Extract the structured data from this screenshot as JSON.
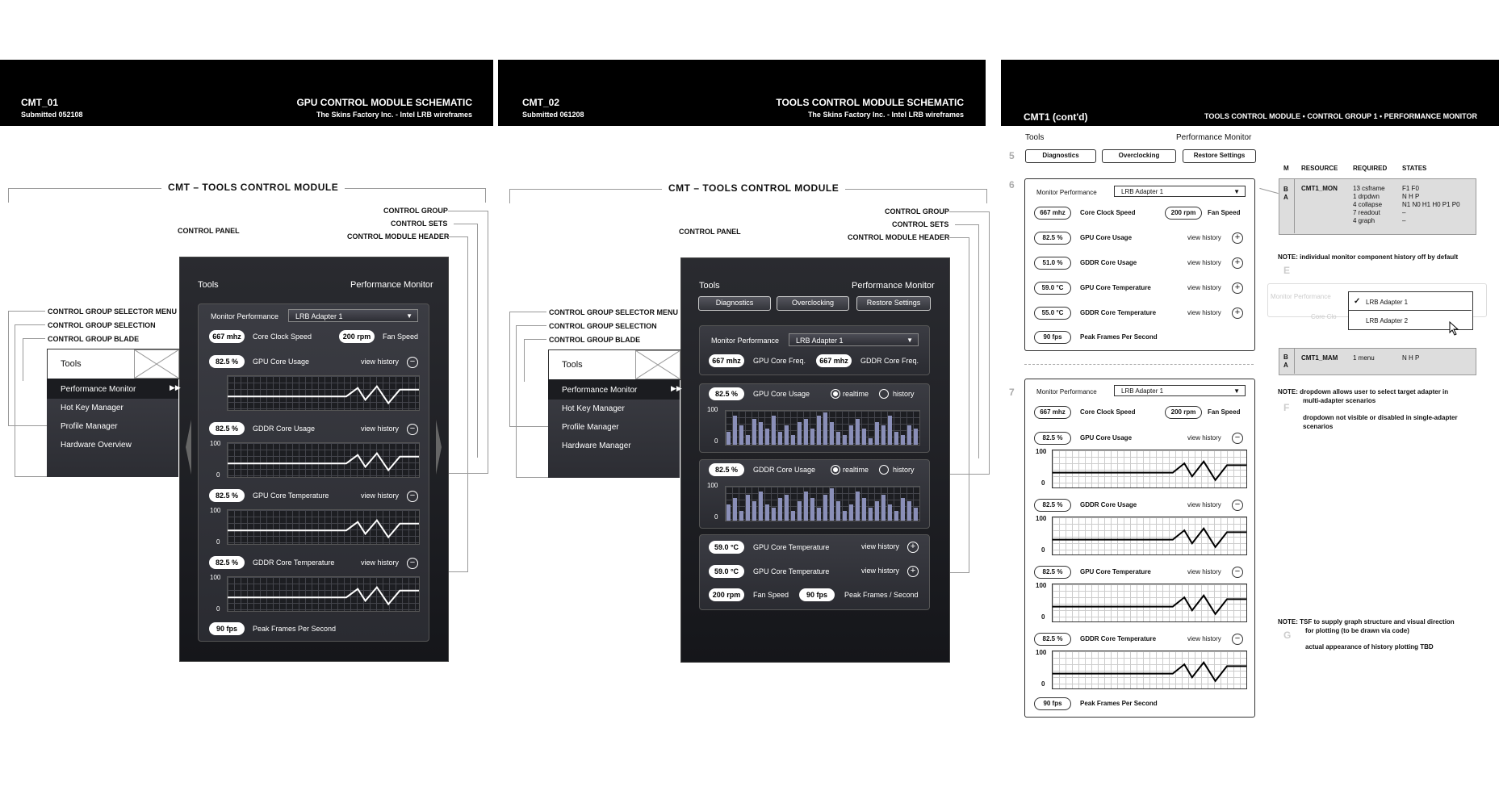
{
  "boards": [
    {
      "code": "CMT_01",
      "submitted": "Submitted 052108",
      "title": "GPU CONTROL MODULE SCHEMATIC",
      "subtitle": "The Skins Factory Inc. - Intel LRB wireframes",
      "section": "CMT – TOOLS CONTROL MODULE"
    },
    {
      "code": "CMT_02",
      "submitted": "Submitted 061208",
      "title": "TOOLS CONTROL MODULE SCHEMATIC",
      "subtitle": "The Skins Factory Inc. - Intel LRB wireframes",
      "section": "CMT – TOOLS CONTROL MODULE"
    },
    {
      "code": "CMT1 (cont'd)",
      "title": "TOOLS CONTROL MODULE • CONTROL GROUP 1 • PERFORMANCE MONITOR"
    }
  ],
  "callouts": {
    "control_group": "CONTROL GROUP",
    "control_sets": "CONTROL SETS",
    "control_module_header": "CONTROL MODULE HEADER",
    "control_panel": "CONTROL PANEL",
    "cg_selector_menu": "CONTROL GROUP SELECTOR MENU",
    "cg_selection": "CONTROL GROUP SELECTION",
    "cg_blade": "CONTROL GROUP BLADE"
  },
  "panel": {
    "tools": "Tools",
    "perf_monitor": "Performance Monitor"
  },
  "blade1": {
    "selected": "Tools",
    "items": [
      "Performance Monitor",
      "Hot Key Manager",
      "Profile Manager",
      "Hardware Overview"
    ]
  },
  "blade2": {
    "selected": "Tools",
    "items": [
      "Performance Monitor",
      "Hot Key Manager",
      "Profile Manager",
      "Hardware Manager"
    ]
  },
  "p1": {
    "monitor_label": "Monitor Performance",
    "adapter": "LRB Adapter 1",
    "clock": "667 mhz",
    "clock_label": "Core Clock Speed",
    "fan": "200 rpm",
    "fan_label": "Fan Speed",
    "rows": [
      {
        "value": "82.5 %",
        "label": "GPU Core Usage",
        "history": "view history"
      },
      {
        "value": "82.5 %",
        "label": "GDDR Core Usage",
        "history": "view history"
      },
      {
        "value": "82.5 %",
        "label": "GPU Core Temperature",
        "history": "view history"
      },
      {
        "value": "82.5 %",
        "label": "GDDR Core Temperature",
        "history": "view history"
      }
    ],
    "ymax": "100",
    "ymin": "0",
    "fps": "90 fps",
    "fps_label": "Peak Frames Per Second"
  },
  "p2": {
    "tabs": [
      "Diagnostics",
      "Overclocking",
      "Restore Settings"
    ],
    "monitor_label": "Monitor Performance",
    "adapter": "LRB Adapter 1",
    "gpu_freq": "667 mhz",
    "gpu_freq_label": "GPU Core Freq.",
    "gddr_freq": "667 mhz",
    "gddr_freq_label": "GDDR Core Freq.",
    "usage": [
      {
        "value": "82.5 %",
        "label": "GPU Core Usage",
        "opt1": "realtime",
        "opt2": "history"
      },
      {
        "value": "82.5 %",
        "label": "GDDR Core Usage",
        "opt1": "realtime",
        "opt2": "history"
      }
    ],
    "ymax": "100",
    "ymin": "0",
    "temps": [
      {
        "value": "59.0 °C",
        "label": "GPU Core Temperature",
        "history": "view history"
      },
      {
        "value": "59.0 °C",
        "label": "GPU Core Temperature",
        "history": "view history"
      }
    ],
    "fan": "200 rpm",
    "fan_label": "Fan Speed",
    "fps": "90 fps",
    "fps_label": "Peak Frames / Second"
  },
  "p3": {
    "tools": "Tools",
    "perf_monitor": "Performance Monitor",
    "tabs": [
      "Diagnostics",
      "Overclocking",
      "Restore Settings"
    ],
    "n5": "5",
    "n6": "6",
    "n7": "7",
    "monitor_label": "Monitor Performance",
    "adapter": "LRB Adapter 1",
    "clock": "667 mhz",
    "clock_label": "Core Clock Speed",
    "fan": "200 rpm",
    "fan_label": "Fan Speed",
    "list6": [
      {
        "value": "82.5 %",
        "label": "GPU Core Usage",
        "history": "view history"
      },
      {
        "value": "51.0 %",
        "label": "GDDR Core Usage",
        "history": "view history"
      },
      {
        "value": "59.0 °C",
        "label": "GPU Core Temperature",
        "history": "view history"
      },
      {
        "value": "55.0 °C",
        "label": "GDDR Core Temperature",
        "history": "view history"
      }
    ],
    "fps": "90 fps",
    "fps_label": "Peak Frames Per Second",
    "list7": [
      {
        "value": "82.5 %",
        "label": "GPU Core Usage",
        "history": "view history"
      },
      {
        "value": "82.5 %",
        "label": "GDDR Core Usage",
        "history": "view history"
      },
      {
        "value": "82.5 %",
        "label": "GPU Core Temperature",
        "history": "view history"
      },
      {
        "value": "82.5 %",
        "label": "GDDR Core Temperature",
        "history": "view history"
      }
    ],
    "ymax": "100",
    "ymin": "0"
  },
  "table": {
    "headers": [
      "M",
      "RESOURCE",
      "REQUIRED",
      "STATES"
    ],
    "row1": {
      "m": "B\nA",
      "resource": "CMT1_MON",
      "required": "13 csframe\n1 drpdwn\n4 collapse\n7 readout\n4 graph",
      "states": "F1 F0\nN H P\nN1 N0 H1 H0 P1 P0\n–\n–"
    },
    "row2": {
      "m": "B\nA",
      "resource": "CMT1_MAM",
      "required": "1 menu",
      "states": "N H P"
    }
  },
  "notes": {
    "e_letter": "E",
    "f_letter": "F",
    "g_letter": "G",
    "note1": "NOTE:  individual monitor component history off by default",
    "note2a": "NOTE:  dropdown allows user to select target adapter in",
    "note2b": "multi-adapter scenarios",
    "note2c": "dropdown not visible or disabled in single-adapter",
    "note2d": "scenarios",
    "note3a": "NOTE:  TSF to supply graph structure and visual direction",
    "note3b": "for plotting (to be drawn via code)",
    "note3c": "actual appearance of history plotting TBD",
    "ghost_monitor": "Monitor Performance",
    "ghost_core": "Core Clo",
    "dd_opt1": "LRB Adapter 1",
    "dd_opt2": "LRB Adapter 2"
  }
}
